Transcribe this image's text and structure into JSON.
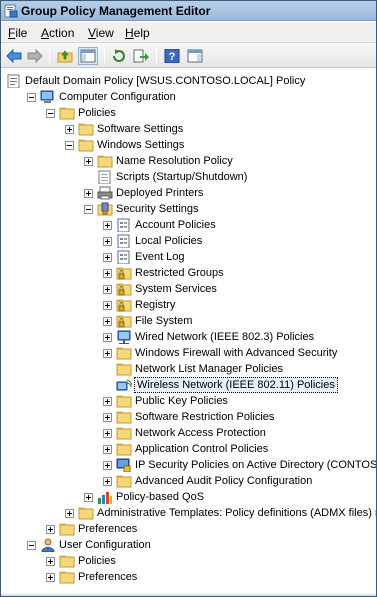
{
  "window": {
    "title": "Group Policy Management Editor"
  },
  "menu": [
    {
      "label": "File",
      "u": "F",
      "rest": "ile"
    },
    {
      "label": "Action",
      "u": "A",
      "rest": "ction"
    },
    {
      "label": "View",
      "u": "V",
      "rest": "iew"
    },
    {
      "label": "Help",
      "u": "H",
      "rest": "elp"
    }
  ],
  "toolbar": {
    "buttons": [
      "back-icon",
      "forward-icon",
      "up-folder-icon",
      "show-hide-tree-icon",
      "refresh-icon",
      "export-list-icon",
      "help-icon",
      "properties-pane-icon"
    ]
  },
  "tree": [
    {
      "label": "Default Domain Policy [WSUS.CONTOSO.LOCAL] Policy",
      "icon": "gpo-icon",
      "depth": 0,
      "exp": "none"
    },
    {
      "label": "Computer Configuration",
      "icon": "computer-icon",
      "depth": 1,
      "exp": "minus"
    },
    {
      "label": "Policies",
      "icon": "folder-icon",
      "depth": 2,
      "exp": "minus"
    },
    {
      "label": "Software Settings",
      "icon": "folder-icon",
      "depth": 3,
      "exp": "plus"
    },
    {
      "label": "Windows Settings",
      "icon": "folder-icon",
      "depth": 3,
      "exp": "minus"
    },
    {
      "label": "Name Resolution Policy",
      "icon": "folder-icon",
      "depth": 4,
      "exp": "plus"
    },
    {
      "label": "Scripts (Startup/Shutdown)",
      "icon": "scripts-icon",
      "depth": 4,
      "exp": "none"
    },
    {
      "label": "Deployed Printers",
      "icon": "printer-icon",
      "depth": 4,
      "exp": "plus"
    },
    {
      "label": "Security Settings",
      "icon": "security-icon",
      "depth": 4,
      "exp": "minus"
    },
    {
      "label": "Account Policies",
      "icon": "policy-doc-icon",
      "depth": 5,
      "exp": "plus"
    },
    {
      "label": "Local Policies",
      "icon": "policy-doc-icon",
      "depth": 5,
      "exp": "plus"
    },
    {
      "label": "Event Log",
      "icon": "policy-doc-icon",
      "depth": 5,
      "exp": "plus"
    },
    {
      "label": "Restricted Groups",
      "icon": "lock-folder-icon",
      "depth": 5,
      "exp": "plus"
    },
    {
      "label": "System Services",
      "icon": "lock-folder-icon",
      "depth": 5,
      "exp": "plus"
    },
    {
      "label": "Registry",
      "icon": "lock-folder-icon",
      "depth": 5,
      "exp": "plus"
    },
    {
      "label": "File System",
      "icon": "lock-folder-icon",
      "depth": 5,
      "exp": "plus"
    },
    {
      "label": "Wired Network (IEEE 802.3) Policies",
      "icon": "wired-network-icon",
      "depth": 5,
      "exp": "plus"
    },
    {
      "label": "Windows Firewall with Advanced Security",
      "icon": "folder-icon",
      "depth": 5,
      "exp": "plus"
    },
    {
      "label": "Network List Manager Policies",
      "icon": "folder-icon",
      "depth": 5,
      "exp": "none"
    },
    {
      "label": "Wireless Network (IEEE 802.11) Policies",
      "icon": "wireless-icon",
      "depth": 5,
      "exp": "none",
      "selected": true
    },
    {
      "label": "Public Key Policies",
      "icon": "folder-icon",
      "depth": 5,
      "exp": "plus"
    },
    {
      "label": "Software Restriction Policies",
      "icon": "folder-icon",
      "depth": 5,
      "exp": "plus"
    },
    {
      "label": "Network Access Protection",
      "icon": "folder-icon",
      "depth": 5,
      "exp": "plus"
    },
    {
      "label": "Application Control Policies",
      "icon": "folder-icon",
      "depth": 5,
      "exp": "plus"
    },
    {
      "label": "IP Security Policies on Active Directory (CONTOSO.LOCAL)",
      "icon": "ipsec-icon",
      "depth": 5,
      "exp": "plus"
    },
    {
      "label": "Advanced Audit Policy Configuration",
      "icon": "folder-icon",
      "depth": 5,
      "exp": "plus"
    },
    {
      "label": "Policy-based QoS",
      "icon": "qos-icon",
      "depth": 4,
      "exp": "plus"
    },
    {
      "label": "Administrative Templates: Policy definitions (ADMX files) retrie",
      "icon": "folder-icon",
      "depth": 3,
      "exp": "plus"
    },
    {
      "label": "Preferences",
      "icon": "folder-icon",
      "depth": 2,
      "exp": "plus"
    },
    {
      "label": "User Configuration",
      "icon": "user-icon",
      "depth": 1,
      "exp": "minus"
    },
    {
      "label": "Policies",
      "icon": "folder-icon",
      "depth": 2,
      "exp": "plus"
    },
    {
      "label": "Preferences",
      "icon": "folder-icon",
      "depth": 2,
      "exp": "plus"
    }
  ]
}
